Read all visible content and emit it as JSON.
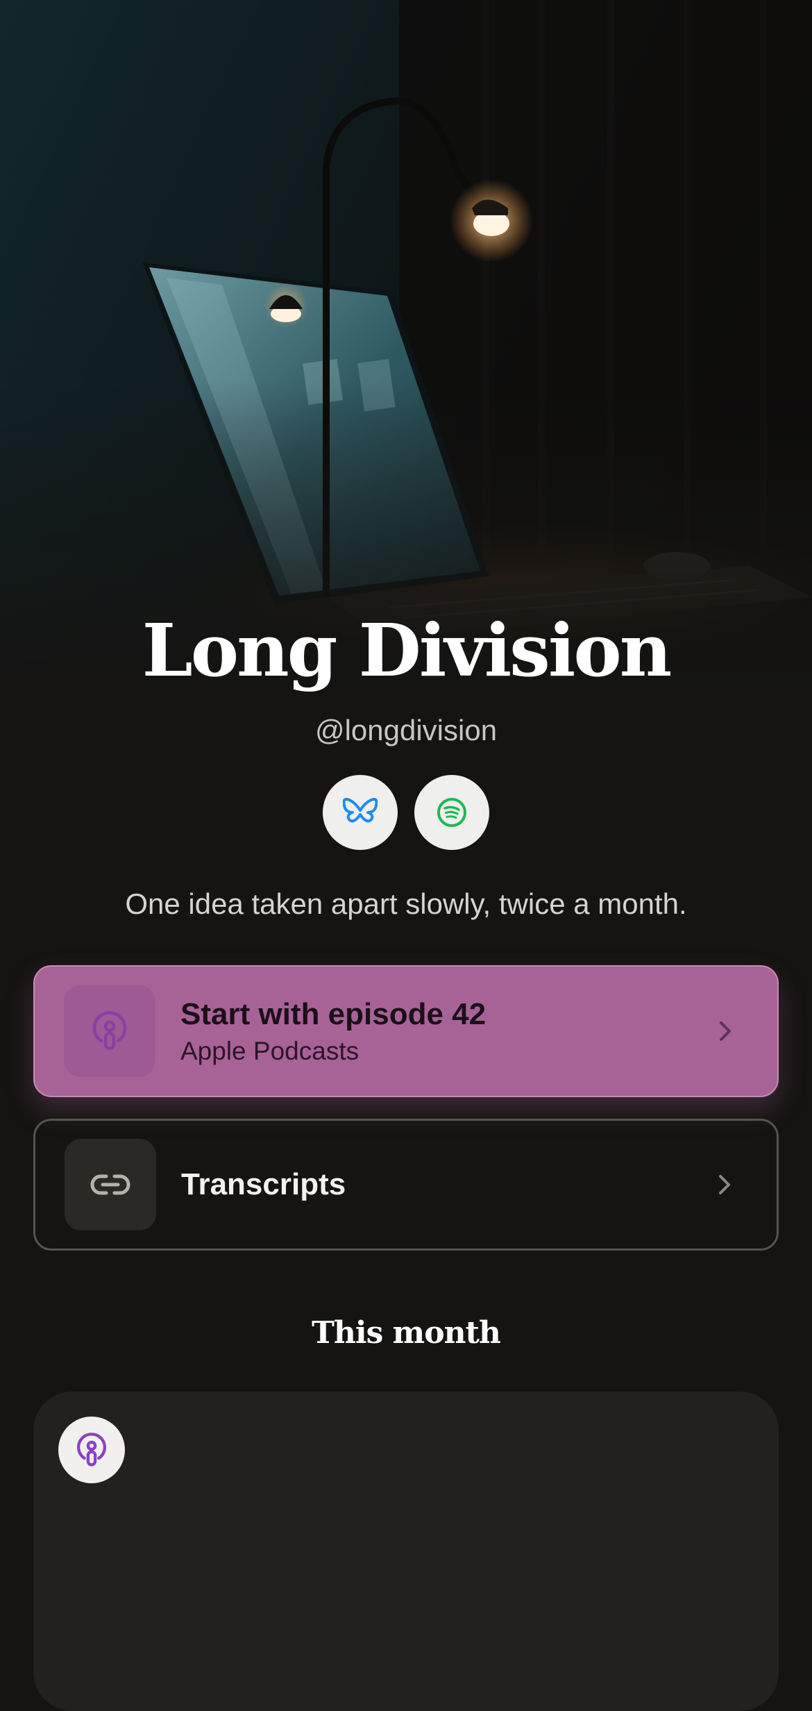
{
  "profile": {
    "title": "Long Division",
    "handle": "@longdivision",
    "tagline": "One idea taken apart slowly, twice a month."
  },
  "socials": [
    {
      "icon": "bluesky-butterfly-icon",
      "color": "#1d8cf0"
    },
    {
      "icon": "spotify-icon",
      "color": "#1db954"
    }
  ],
  "links": {
    "featured": {
      "title": "Start with episode 42",
      "subtitle": "Apple Podcasts",
      "icon": "podcast-icon",
      "background": "#a86396"
    },
    "transcripts": {
      "title": "Transcripts",
      "icon": "link-icon"
    }
  },
  "sections": {
    "this_month": {
      "title": "This month",
      "badge_icon": "podcast-icon",
      "badge_color": "#8e3fc4"
    }
  },
  "colors": {
    "background": "#151412",
    "accent": "#a86396"
  }
}
